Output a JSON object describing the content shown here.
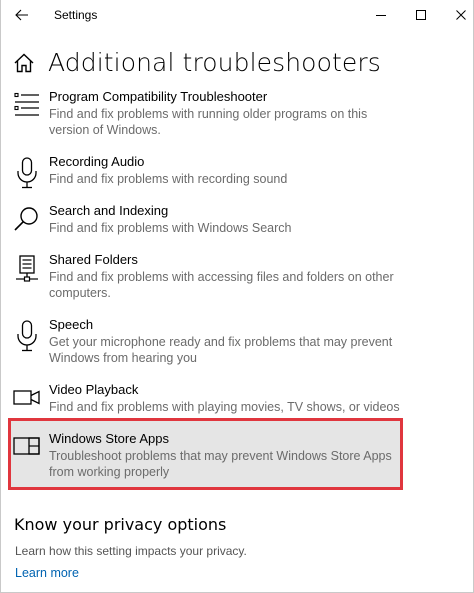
{
  "window": {
    "title": "Settings",
    "back_icon": "arrow-left-icon",
    "minimize_icon": "minimize-icon",
    "maximize_icon": "maximize-icon",
    "close_icon": "close-icon"
  },
  "page": {
    "home_icon": "home-icon",
    "title": "Additional troubleshooters"
  },
  "troubleshooters": [
    {
      "icon": "list-checklist-icon",
      "name": "Program Compatibility Troubleshooter",
      "description": "Find and fix problems with running older programs on this version of Windows."
    },
    {
      "icon": "microphone-icon",
      "name": "Recording Audio",
      "description": "Find and fix problems with recording sound"
    },
    {
      "icon": "search-icon",
      "name": "Search and Indexing",
      "description": "Find and fix problems with Windows Search"
    },
    {
      "icon": "network-folder-icon",
      "name": "Shared Folders",
      "description": "Find and fix problems with accessing files and folders on other computers."
    },
    {
      "icon": "microphone-icon",
      "name": "Speech",
      "description": "Get your microphone ready and fix problems that may prevent Windows from hearing you"
    },
    {
      "icon": "video-camera-icon",
      "name": "Video Playback",
      "description": "Find and fix problems with playing movies, TV shows, or videos"
    },
    {
      "icon": "store-apps-icon",
      "name": "Windows Store Apps",
      "description": "Troubleshoot problems that may prevent Windows Store Apps from working properly",
      "selected": true
    }
  ],
  "privacy": {
    "title": "Know your privacy options",
    "description": "Learn how this setting impacts your privacy.",
    "link": "Learn more"
  },
  "colors": {
    "highlight_border": "#e0363e",
    "selected_bg": "#e5e5e5",
    "link": "#0063b1"
  }
}
